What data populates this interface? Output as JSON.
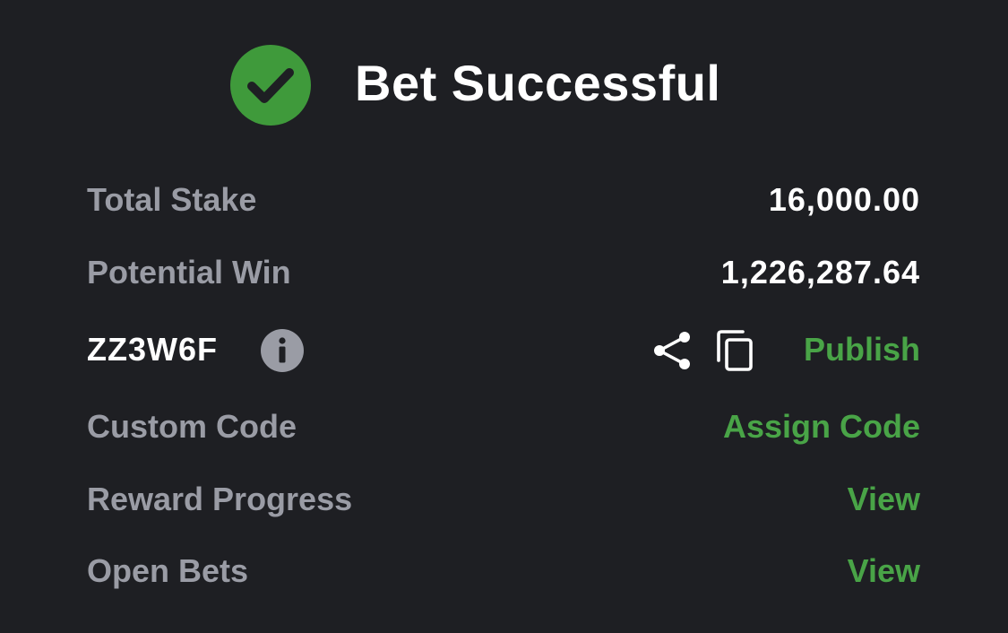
{
  "header": {
    "icon": "check-circle-icon",
    "title": "Bet Successful"
  },
  "summary": {
    "total_stake_label": "Total Stake",
    "total_stake_value": "16,000.00",
    "potential_win_label": "Potential Win",
    "potential_win_value": "1,226,287.64"
  },
  "booking": {
    "code": "ZZ3W6F",
    "info_icon": "info-icon",
    "share_icon": "share-icon",
    "copy_icon": "copy-icon",
    "publish_label": "Publish"
  },
  "custom_code": {
    "label": "Custom Code",
    "action": "Assign Code"
  },
  "reward_progress": {
    "label": "Reward Progress",
    "action": "View"
  },
  "open_bets": {
    "label": "Open Bets",
    "action": "View"
  },
  "colors": {
    "background": "#1e1f23",
    "accent_green": "#49a447",
    "check_green": "#3f9a3b",
    "label_gray": "#9a9ca5",
    "text_white": "#ffffff"
  }
}
